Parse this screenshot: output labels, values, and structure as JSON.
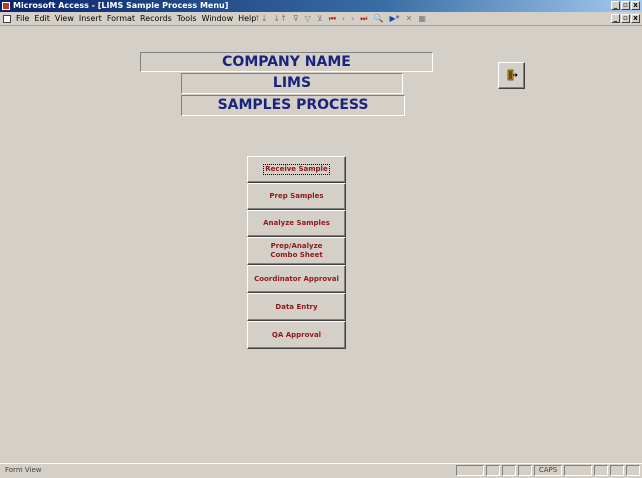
{
  "window": {
    "title": "Microsoft Access - [LIMS Sample Process Menu]"
  },
  "menubar": {
    "items": [
      "File",
      "Edit",
      "View",
      "Insert",
      "Format",
      "Records",
      "Tools",
      "Window",
      "Help"
    ]
  },
  "form": {
    "company_name": "COMPANY NAME",
    "system_name": "LIMS",
    "section_name": "SAMPLES PROCESS",
    "exit_icon": "exit-door-icon",
    "buttons": [
      "Receive Sample",
      "Prep Samples",
      "Analyze Samples",
      "Prep/Analyze\nCombo Sheet",
      "Coordinator Approval",
      "Data Entry",
      "QA Approval"
    ]
  },
  "statusbar": {
    "mode": "Form View",
    "caps": "CAPS"
  },
  "colors": {
    "form_background": "#d4d0c8",
    "heading_text": "#1a237e",
    "button_text": "#8b1a1a",
    "titlebar": "#0a246a"
  }
}
